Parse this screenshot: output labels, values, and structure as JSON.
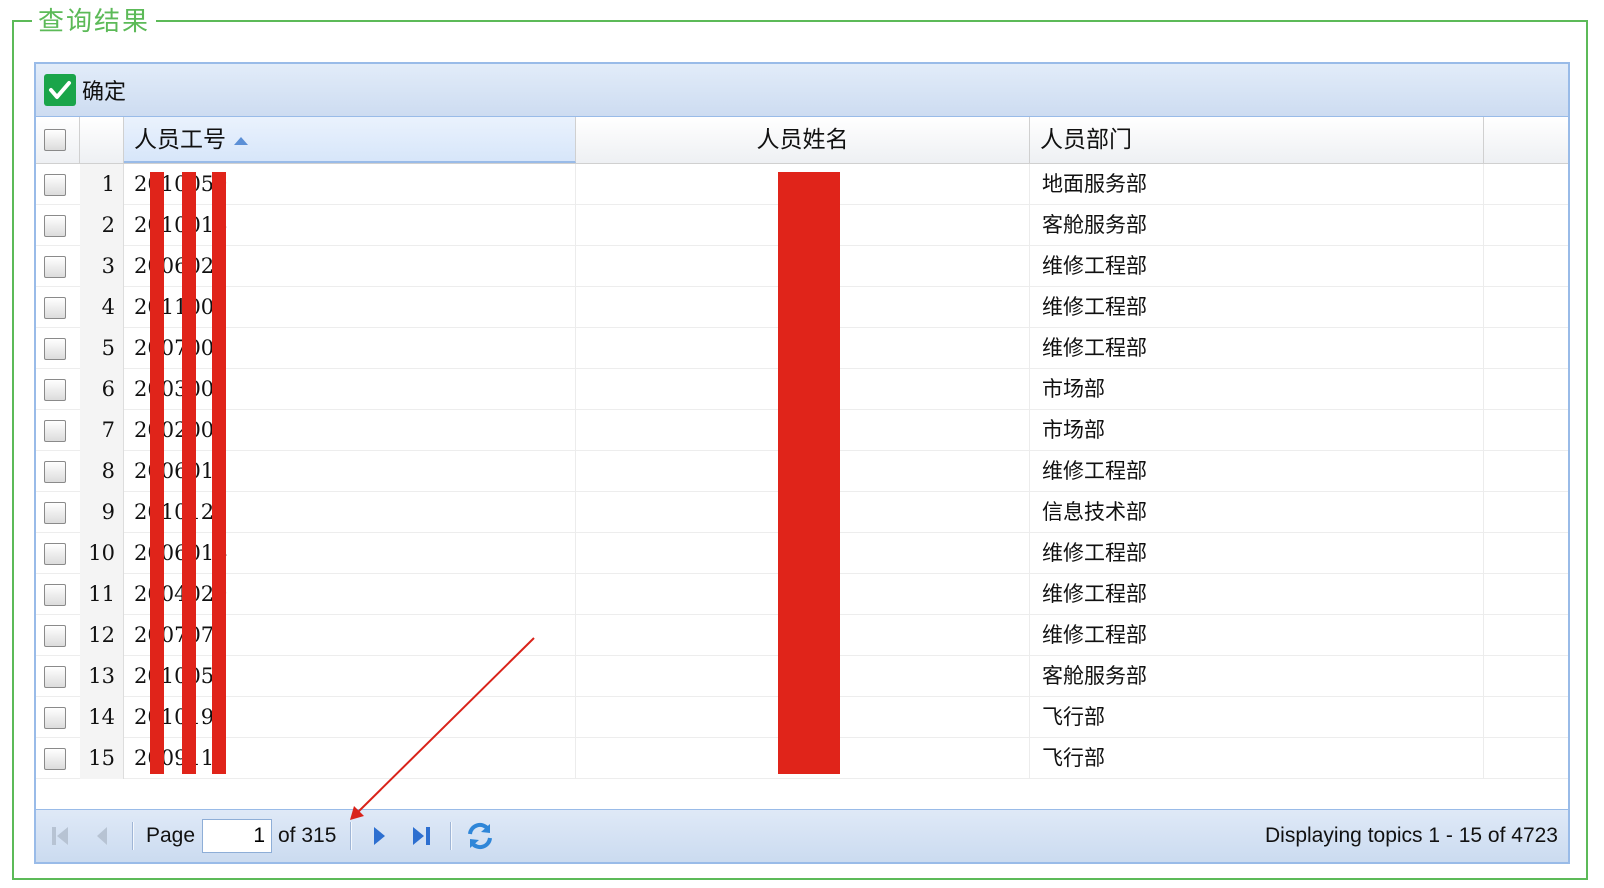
{
  "legend": "查询结果",
  "toolbar": {
    "confirm_label": "确定"
  },
  "columns": {
    "id": "人员工号",
    "name": "人员姓名",
    "dept": "人员部门"
  },
  "rows": [
    {
      "num": "1",
      "id": "2010059",
      "name": "",
      "dept": "地面服务部"
    },
    {
      "num": "2",
      "id": "2010016",
      "name": "",
      "dept": "客舱服务部"
    },
    {
      "num": "3",
      "id": "2006027",
      "name": "",
      "dept": "维修工程部"
    },
    {
      "num": "4",
      "id": "2011005",
      "name": "",
      "dept": "维修工程部"
    },
    {
      "num": "5",
      "id": "2007001",
      "name": "",
      "dept": "维修工程部"
    },
    {
      "num": "6",
      "id": "2003002",
      "name": "",
      "dept": "市场部"
    },
    {
      "num": "7",
      "id": "2002007",
      "name": "",
      "dept": "市场部"
    },
    {
      "num": "8",
      "id": "2006017",
      "name": "",
      "dept": "维修工程部"
    },
    {
      "num": "9",
      "id": "2010127",
      "name": "",
      "dept": "信息技术部"
    },
    {
      "num": "10",
      "id": "2006014",
      "name": "",
      "dept": "维修工程部"
    },
    {
      "num": "11",
      "id": "2004029",
      "name": "",
      "dept": "维修工程部"
    },
    {
      "num": "12",
      "id": "2007075",
      "name": "",
      "dept": "维修工程部"
    },
    {
      "num": "13",
      "id": "2010057",
      "name": "",
      "dept": "客舱服务部"
    },
    {
      "num": "14",
      "id": "2010195",
      "name": "",
      "dept": "飞行部"
    },
    {
      "num": "15",
      "id": "2009112",
      "name": "",
      "dept": "飞行部"
    }
  ],
  "pager": {
    "page_label": "Page",
    "current_page": "1",
    "of_label": "of 315",
    "display_text": "Displaying topics 1 - 15 of 4723"
  },
  "icons": {
    "first": "first-page-icon",
    "prev": "prev-page-icon",
    "next": "next-page-icon",
    "last": "last-page-icon",
    "refresh": "refresh-icon",
    "check": "check-icon"
  },
  "colors": {
    "legend_green": "#5cba58",
    "redaction_red": "#e0241a",
    "panel_border": "#99bbe8"
  }
}
